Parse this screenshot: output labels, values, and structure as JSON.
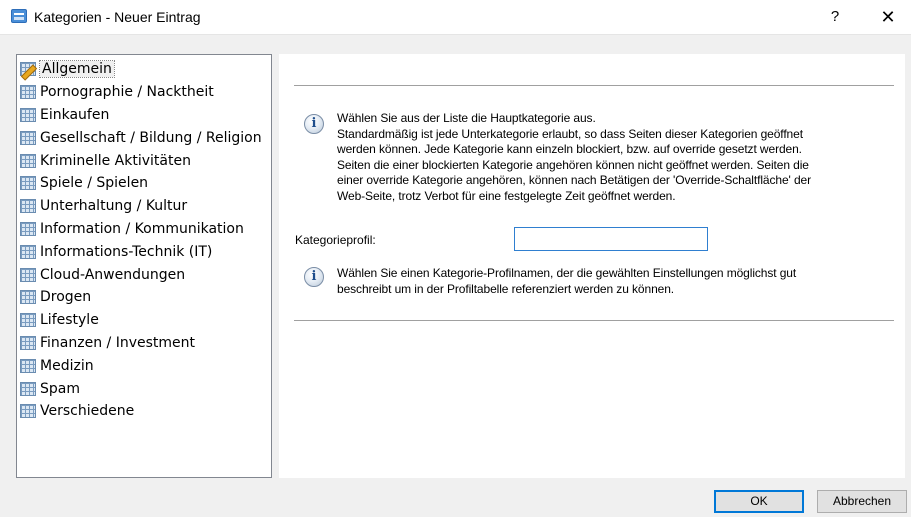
{
  "window": {
    "title": "Kategorien - Neuer Eintrag",
    "help_label": "?",
    "close_label": "✕"
  },
  "tree": {
    "selected_index": 0,
    "items": [
      {
        "label": "Allgemein",
        "icon": "edit-grid-icon"
      },
      {
        "label": "Pornographie / Nacktheit",
        "icon": "grid-icon"
      },
      {
        "label": "Einkaufen",
        "icon": "grid-icon"
      },
      {
        "label": "Gesellschaft / Bildung / Religion",
        "icon": "grid-icon"
      },
      {
        "label": "Kriminelle Aktivitäten",
        "icon": "grid-icon"
      },
      {
        "label": "Spiele / Spielen",
        "icon": "grid-icon"
      },
      {
        "label": "Unterhaltung / Kultur",
        "icon": "grid-icon"
      },
      {
        "label": "Information / Kommunikation",
        "icon": "grid-icon"
      },
      {
        "label": "Informations-Technik (IT)",
        "icon": "grid-icon"
      },
      {
        "label": "Cloud-Anwendungen",
        "icon": "grid-icon"
      },
      {
        "label": "Drogen",
        "icon": "grid-icon"
      },
      {
        "label": "Lifestyle",
        "icon": "grid-icon"
      },
      {
        "label": "Finanzen / Investment",
        "icon": "grid-icon"
      },
      {
        "label": "Medizin",
        "icon": "grid-icon"
      },
      {
        "label": "Spam",
        "icon": "grid-icon"
      },
      {
        "label": "Verschiedene",
        "icon": "grid-icon"
      }
    ]
  },
  "panel": {
    "info_icon_glyph": "i",
    "info1_lines": [
      "Wählen Sie aus der Liste die Hauptkategorie aus.",
      "Standardmäßig ist jede Unterkategorie erlaubt, so dass Seiten dieser Kategorien geöffnet",
      "werden können. Jede Kategorie kann einzeln blockiert, bzw. auf override gesetzt werden.",
      "Seiten die einer blockierten Kategorie angehören können nicht geöffnet werden. Seiten die",
      "einer override Kategorie angehören, können nach Betätigen der 'Override-Schaltfläche' der",
      "Web-Seite, trotz Verbot für eine festgelegte Zeit geöffnet werden."
    ],
    "profile_label": "Kategorieprofil:",
    "profile_value": "",
    "info2_lines": [
      "Wählen Sie einen Kategorie-Profilnamen, der die gewählten Einstellungen möglichst gut",
      "beschreibt um in der Profiltabelle referenziert werden zu können."
    ]
  },
  "buttons": {
    "ok_label": "OK",
    "cancel_label": "Abbrechen"
  }
}
